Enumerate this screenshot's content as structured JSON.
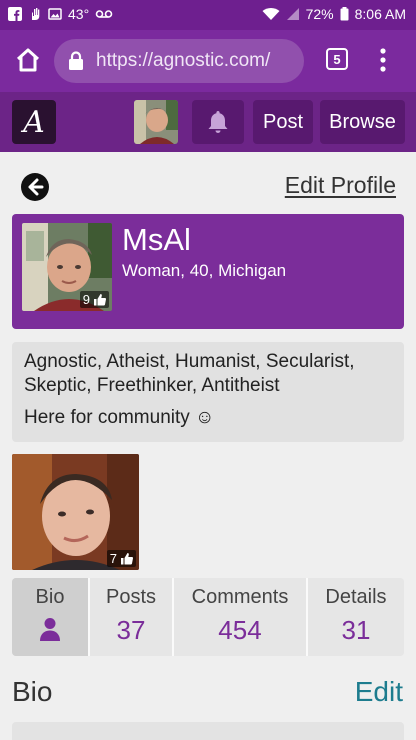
{
  "status_bar": {
    "temperature": "43°",
    "battery": "72%",
    "time": "8:06 AM"
  },
  "browser": {
    "url": "https://agnostic.com/",
    "tab_count": "5"
  },
  "site_header": {
    "logo_letter": "A",
    "post_label": "Post",
    "browse_label": "Browse"
  },
  "profile": {
    "edit_profile_label": "Edit Profile",
    "username": "MsAl",
    "info": "Woman, 40, Michigan",
    "photo_likes": "9",
    "beliefs": "Agnostic, Atheist, Humanist, Secularist, Skeptic, Freethinker, Antitheist",
    "tagline": "Here for community ☺",
    "photo2_likes": "7"
  },
  "stats": {
    "bio_label": "Bio",
    "posts_label": "Posts",
    "posts_value": "37",
    "comments_label": "Comments",
    "comments_value": "454",
    "details_label": "Details",
    "details_value": "31"
  },
  "bio_section": {
    "heading": "Bio",
    "edit_label": "Edit"
  },
  "colors": {
    "brand_purple": "#7b2d9a",
    "header_purple": "#6c2487",
    "link_teal": "#1d7c8e"
  }
}
